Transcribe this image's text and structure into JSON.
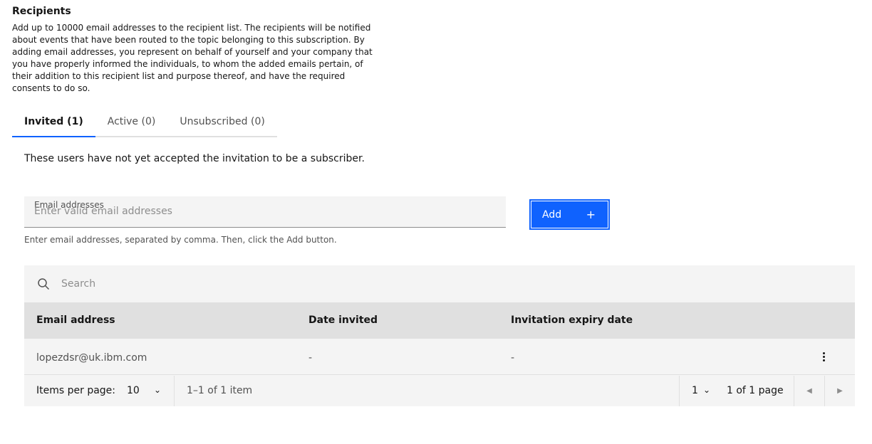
{
  "section": {
    "title": "Recipients",
    "description": "Add up to 10000 email addresses to the recipient list. The recipients will be notified about events that have been routed to the topic belonging to this subscription. By adding email addresses, you represent on behalf of yourself and your company that you have properly informed the individuals, to whom the added emails pertain, of their addition to this recipient list and purpose thereof, and have the required consents to do so."
  },
  "tabs": [
    {
      "label": "Invited (1)",
      "selected": true
    },
    {
      "label": "Active (0)",
      "selected": false
    },
    {
      "label": "Unsubscribed (0)",
      "selected": false
    }
  ],
  "tab_description": "These users have not yet accepted the invitation to be a subscriber.",
  "email_form": {
    "label": "Email addresses",
    "placeholder": "Enter valid email addresses",
    "value": "",
    "helper": "Enter email addresses, separated by comma. Then, click the Add button.",
    "add_label": "Add",
    "add_icon": "+"
  },
  "table": {
    "search_placeholder": "Search",
    "columns": [
      "Email address",
      "Date invited",
      "Invitation expiry date"
    ],
    "rows": [
      {
        "email": "lopezdsr@uk.ibm.com",
        "date_invited": "-",
        "expiry": "-"
      }
    ]
  },
  "pagination": {
    "items_per_page_label": "Items per page:",
    "items_per_page": "10",
    "range": "1–1 of 1 item",
    "page": "1",
    "page_of": "1 of 1 page"
  },
  "colors": {
    "accent": "#0f62fe",
    "field_bg": "#f4f4f4",
    "header_bg": "#e0e0e0"
  }
}
